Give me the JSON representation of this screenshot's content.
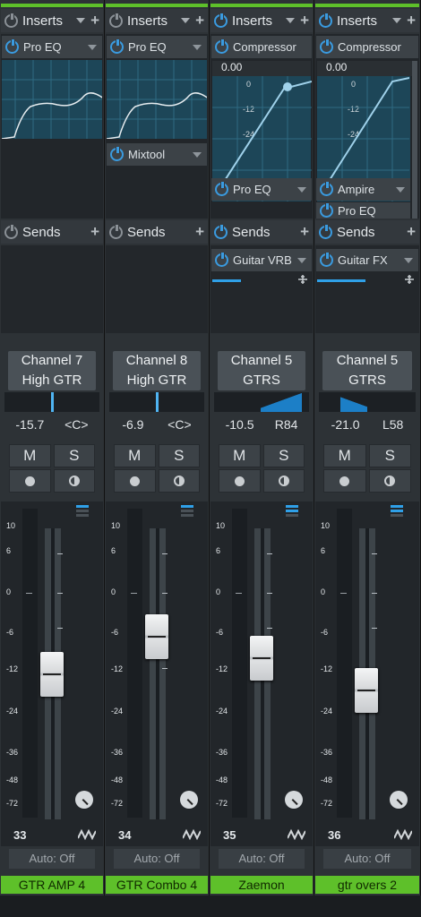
{
  "colors": {
    "accent_green": "#5ec02a",
    "accent_blue": "#2fa0e8",
    "strip_bg": "#2d3236"
  },
  "icons": [
    "power-icon",
    "dropdown-triangle-icon",
    "plus-icon",
    "record-icon",
    "monitor-icon",
    "pan-knob-icon",
    "waveform-icon"
  ],
  "labels": {
    "inserts": "Inserts",
    "sends": "Sends",
    "mute": "M",
    "solo": "S",
    "auto": "Auto: Off"
  },
  "scale": [
    "10",
    "6",
    "0",
    "-6",
    "-12",
    "-24",
    "-36",
    "-48",
    "-72"
  ],
  "channels": [
    {
      "channel": "Channel 7",
      "route": "High GTR",
      "volume": "-15.7",
      "pan": "<C>",
      "inserts": [
        "Pro EQ"
      ],
      "inserts_extra": [],
      "sends": [],
      "comp_value": "",
      "number": "33",
      "name": "GTR AMP 4",
      "fader_level_db": -15.7,
      "pan_value": "center"
    },
    {
      "channel": "Channel 8",
      "route": "High GTR",
      "volume": "-6.9",
      "pan": "<C>",
      "inserts": [
        "Pro EQ",
        "Mixtool"
      ],
      "inserts_extra": [],
      "sends": [],
      "comp_value": "",
      "number": "34",
      "name": "GTR Combo 4",
      "fader_level_db": -6.9,
      "pan_value": "center"
    },
    {
      "channel": "Channel 5",
      "route": "GTRS",
      "volume": "-10.5",
      "pan": "R84",
      "inserts": [
        "Compressor",
        "Pro EQ"
      ],
      "inserts_extra": [],
      "sends": [
        "Guitar VRB"
      ],
      "comp_value": "0.00",
      "comp_ticks": [
        "0",
        "-12",
        "-24"
      ],
      "number": "35",
      "name": "Zaemon",
      "fader_level_db": -10.5,
      "pan_value": "R84"
    },
    {
      "channel": "Channel 5",
      "route": "GTRS",
      "volume": "-21.0",
      "pan": "L58",
      "inserts": [
        "Compressor",
        "Ampire",
        "Pro EQ"
      ],
      "inserts_extra": [],
      "sends": [
        "Guitar FX"
      ],
      "comp_value": "0.00",
      "comp_ticks": [
        "0",
        "-12",
        "-24"
      ],
      "number": "36",
      "name": "gtr overs 2",
      "fader_level_db": -21.0,
      "pan_value": "L58"
    }
  ]
}
